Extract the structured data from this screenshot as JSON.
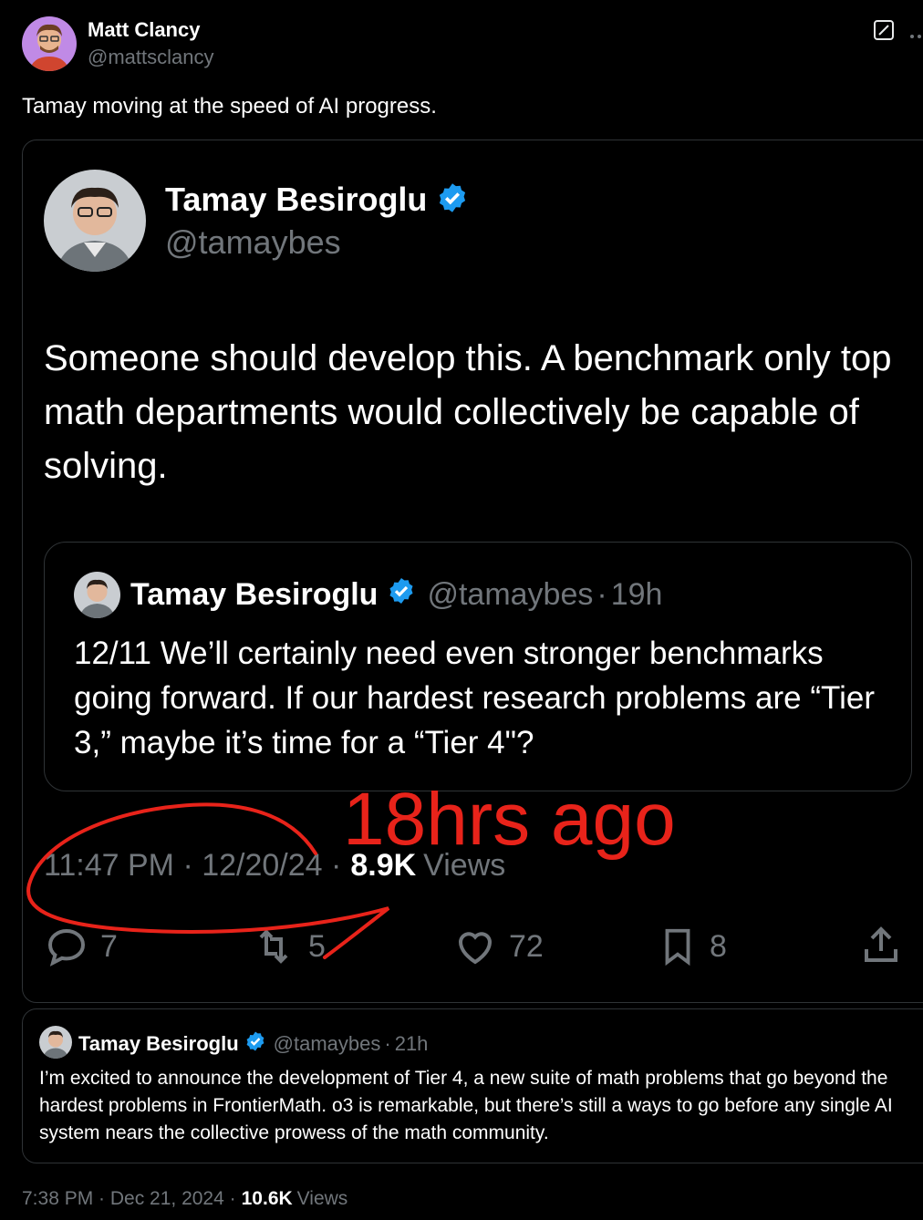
{
  "author": {
    "name": "Matt Clancy",
    "handle": "@mattsclancy"
  },
  "post_text": "Tamay moving at the speed of AI progress.",
  "quoted": {
    "name": "Tamay Besiroglu",
    "handle": "@tamaybes",
    "text": "Someone should develop this. A benchmark only top math departments would collectively be capable of solving.",
    "inner_quote": {
      "name": "Tamay Besiroglu",
      "handle": "@tamaybes",
      "sep": "·",
      "time": "19h",
      "text": "12/11 We’ll certainly need even stronger benchmarks going forward. If our hardest research problems are “Tier 3,” maybe it’s time for a “Tier 4\"?"
    },
    "timestamp": "11:47 PM · 12/20/24 ·",
    "views_count": "8.9K",
    "views_label": "Views",
    "actions": {
      "replies": "7",
      "reposts": "5",
      "likes": "72",
      "bookmarks": "8"
    }
  },
  "annotation": {
    "text": "18hrs ago",
    "color": "#e8231a"
  },
  "reply": {
    "name": "Tamay Besiroglu",
    "handle": "@tamaybes",
    "sep": "·",
    "time": "21h",
    "text": "I’m excited to announce the development of Tier 4, a new suite of math problems that go beyond the hardest problems in FrontierMath. o3 is remarkable, but there’s still a ways to go before any single AI system nears the collective prowess of the math community."
  },
  "footer": {
    "timestamp": "7:38 PM · Dec 21, 2024 ·",
    "views_count": "10.6K",
    "views_label": "Views"
  },
  "colors": {
    "verified": "#1d9bf0",
    "muted": "#71767b",
    "border": "#2f3336"
  }
}
